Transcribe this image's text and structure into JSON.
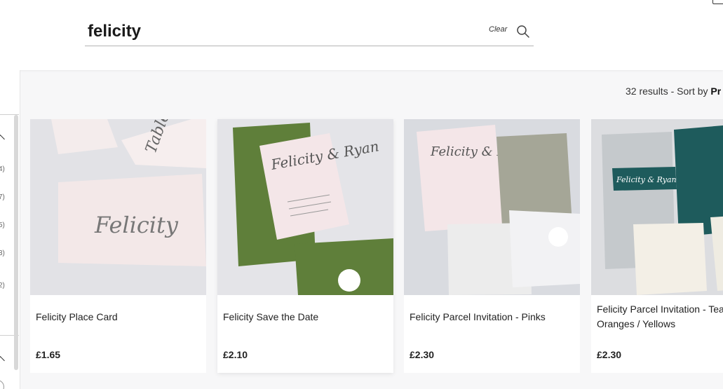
{
  "search": {
    "query": "felicity",
    "clear_label": "Clear"
  },
  "sidebar": {
    "counts": [
      "4)",
      "7)",
      "5)",
      "3)",
      "2)"
    ]
  },
  "results": {
    "count_text": "32 results",
    "separator": "-",
    "sort_label": "Sort by",
    "sort_value": "Pr"
  },
  "products": [
    {
      "title": "Felicity Place Card",
      "price": "£1.65",
      "image_text": "Felicity"
    },
    {
      "title": "Felicity Save the Date",
      "price": "£2.10",
      "image_text": "Felicity & Ryan"
    },
    {
      "title": "Felicity Parcel Invitation - Pinks",
      "price": "£2.30",
      "image_text": "Felicity & Ryan"
    },
    {
      "title": "Felicity Parcel Invitation - Teal Oranges / Yellows",
      "price": "£2.30",
      "image_text": "Felicity & Ryan"
    }
  ]
}
